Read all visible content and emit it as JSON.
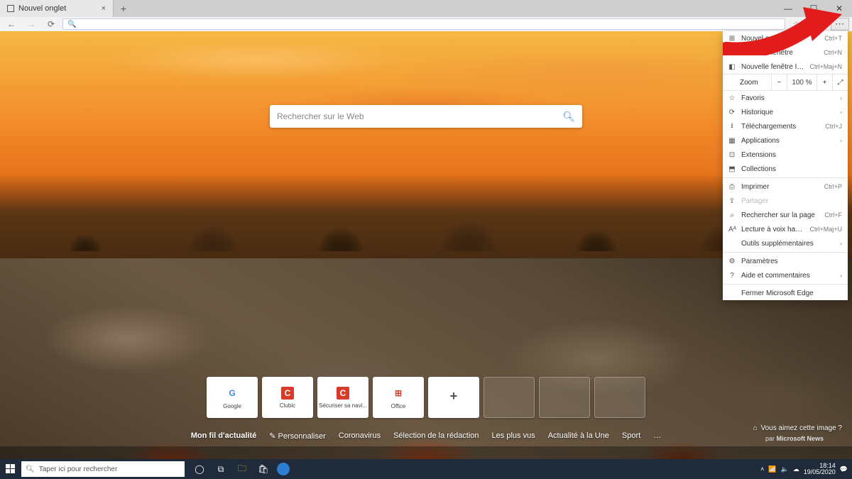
{
  "browser": {
    "tab_title": "Nouvel onglet",
    "addressbar_placeholder": "🔍",
    "window_controls": {
      "minimize": "—",
      "maximize": "☐",
      "close": "✕"
    }
  },
  "search": {
    "placeholder": "Rechercher sur le Web"
  },
  "tiles": {
    "items": [
      {
        "label": "Google",
        "icon": "G",
        "color": "#4285f4"
      },
      {
        "label": "Clubic",
        "icon": "C",
        "color": "#d83b2a"
      },
      {
        "label": "Sécuriser sa navi...",
        "icon": "C",
        "color": "#d83b2a"
      },
      {
        "label": "Office",
        "icon": "⊞",
        "color": "#d83b2a"
      }
    ],
    "add_label": "+"
  },
  "feed_nav": {
    "items": [
      "Mon fil d'actualité",
      "Personnaliser",
      "Coronavirus",
      "Sélection de la rédaction",
      "Les plus vus",
      "Actualité à la Une",
      "Sport",
      "…"
    ],
    "credit_prefix": "par",
    "credit": "Microsoft News"
  },
  "image_prompt": "Vous aimez cette image ?",
  "menu": {
    "items": [
      {
        "ic": "⊞",
        "label": "Nouvel onglet",
        "shortcut": "Ctrl+T"
      },
      {
        "ic": "❐",
        "label": "Nouvelle fenêtre",
        "shortcut": "Ctrl+N"
      },
      {
        "ic": "◧",
        "label": "Nouvelle fenêtre InPrivate",
        "shortcut": "Ctrl+Maj+N"
      }
    ],
    "zoom": {
      "label": "Zoom",
      "value": "100 %",
      "minus": "−",
      "plus": "+",
      "full": "⤢"
    },
    "items2": [
      {
        "ic": "☆",
        "label": "Favoris",
        "chev": true
      },
      {
        "ic": "⟳",
        "label": "Historique",
        "chev": true
      },
      {
        "ic": "⭳",
        "label": "Téléchargements",
        "shortcut": "Ctrl+J"
      },
      {
        "ic": "▦",
        "label": "Applications",
        "chev": true
      },
      {
        "ic": "⊡",
        "label": "Extensions"
      },
      {
        "ic": "⬒",
        "label": "Collections"
      }
    ],
    "items3": [
      {
        "ic": "⎙",
        "label": "Imprimer",
        "shortcut": "Ctrl+P"
      },
      {
        "ic": "⇪",
        "label": "Partager",
        "disabled": true
      },
      {
        "ic": "⌕",
        "label": "Rechercher sur la page",
        "shortcut": "Ctrl+F"
      },
      {
        "ic": "Aᴬ",
        "label": "Lecture à voix haute",
        "shortcut": "Ctrl+Maj+U"
      },
      {
        "ic": "",
        "label": "Outils supplémentaires",
        "chev": true
      }
    ],
    "items4": [
      {
        "ic": "⚙",
        "label": "Paramètres"
      },
      {
        "ic": "?",
        "label": "Aide et commentaires",
        "chev": true
      }
    ],
    "close": "Fermer Microsoft Edge"
  },
  "taskbar": {
    "search_placeholder": "Taper ici pour rechercher",
    "time": "18:14",
    "date": "19/05/2020"
  }
}
